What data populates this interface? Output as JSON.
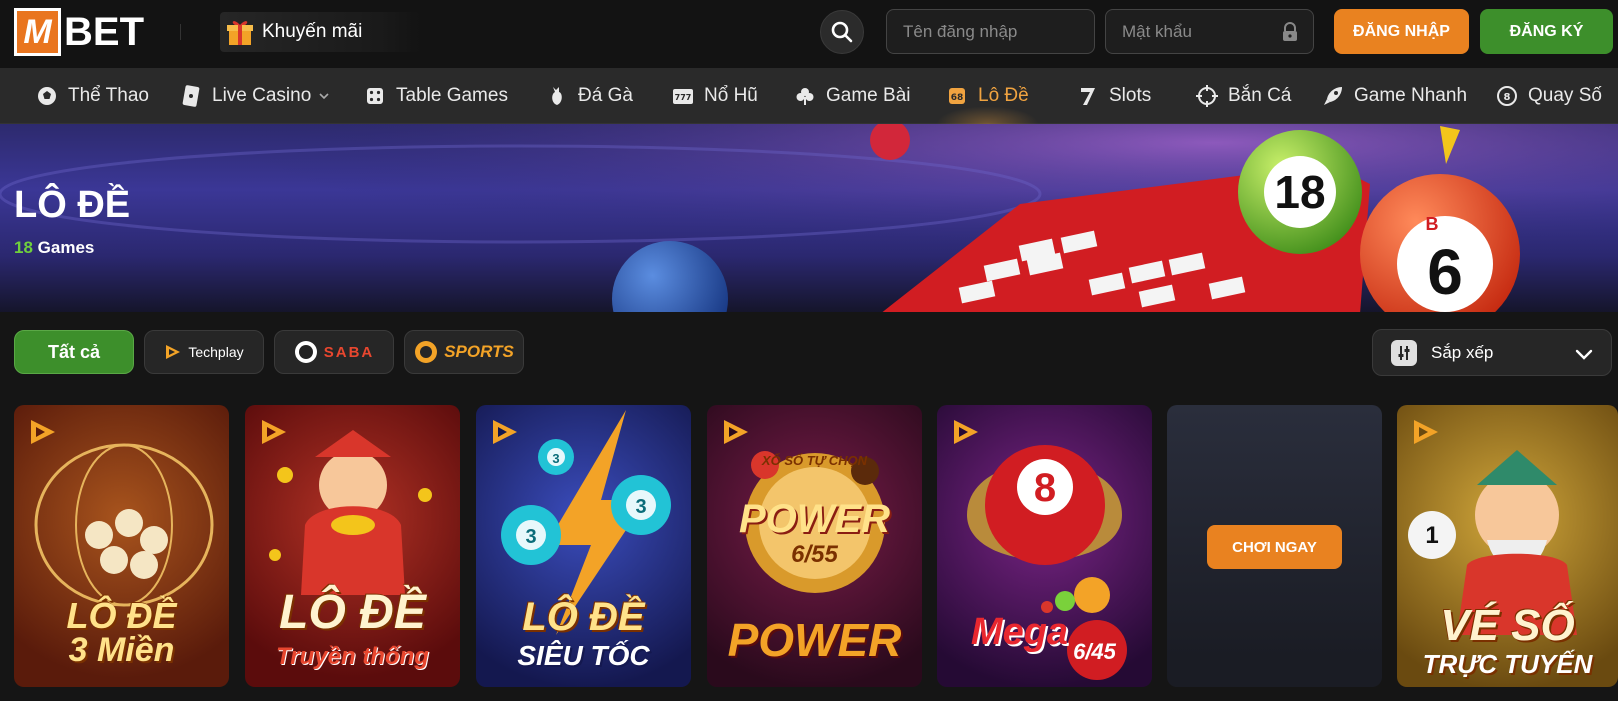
{
  "header": {
    "logo_m": "M",
    "logo_text": "BET",
    "promo_label": "Khuyến mãi",
    "username_placeholder": "Tên đăng nhập",
    "password_placeholder": "Mật khẩu",
    "login_label": "ĐĂNG NHẬP",
    "register_label": "ĐĂNG KÝ"
  },
  "nav": {
    "items": [
      {
        "label": "Thể Thao",
        "icon": "soccer-ball-icon"
      },
      {
        "label": "Live Casino",
        "icon": "playing-card-icon"
      },
      {
        "label": "Table Games",
        "icon": "dice-icon"
      },
      {
        "label": "Đá Gà",
        "icon": "rooster-icon"
      },
      {
        "label": "Nổ Hũ",
        "icon": "slot-machine-icon"
      },
      {
        "label": "Game Bài",
        "icon": "club-suit-icon"
      },
      {
        "label": "Lô Đề",
        "icon": "lottery-icon"
      },
      {
        "label": "Slots",
        "icon": "seven-icon"
      },
      {
        "label": "Bắn Cá",
        "icon": "crosshair-icon"
      },
      {
        "label": "Game Nhanh",
        "icon": "rocket-icon"
      },
      {
        "label": "Quay Số",
        "icon": "lottery-ball-icon"
      }
    ],
    "active": "Lô Đề"
  },
  "banner": {
    "title": "LÔ ĐỀ",
    "count": "18",
    "count_suffix": " Games",
    "ball_green": "18",
    "ball_red_top": "B",
    "ball_red": "6"
  },
  "filters": {
    "all_label": "Tất cả",
    "providers": [
      "Techplay",
      "SABA",
      "SPORTS"
    ],
    "sort_label": "Sắp xếp"
  },
  "games": [
    {
      "title": "LÔ ĐỀ",
      "subtitle": "3 Miền"
    },
    {
      "title": "LÔ ĐỀ",
      "subtitle": "Truyền thống"
    },
    {
      "title": "LÔ ĐỀ",
      "subtitle": "SIÊU TỐC"
    },
    {
      "title": "POWER",
      "subtitle": "6/55",
      "top": "XỔ SỐ TỰ CHỌN"
    },
    {
      "title": "Mega",
      "subtitle": "6/45"
    },
    {
      "play_label": "CHƠI NGAY"
    },
    {
      "title": "VÉ SỐ",
      "subtitle": "TRỰC TUYẾN"
    }
  ],
  "colors": {
    "accent_orange": "#e98220",
    "accent_green": "#3d8f2b",
    "active_nav": "#f0a340"
  }
}
